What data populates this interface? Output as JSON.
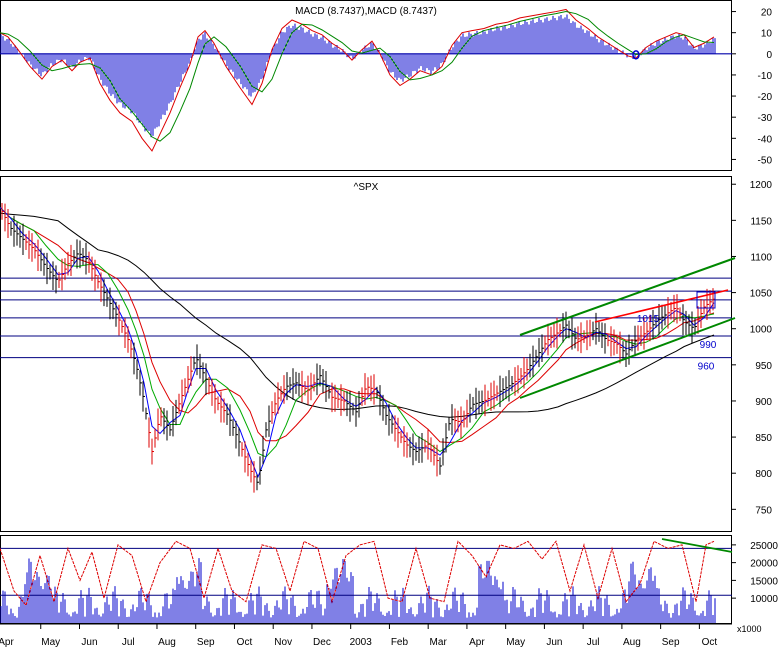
{
  "chart_data": [
    {
      "panel": "macd",
      "type": "bar",
      "title": "MACD (8.7437),MACD (8.7437)",
      "y_ticks": [
        20,
        10,
        0,
        -10,
        -20,
        -30,
        -40,
        -50
      ],
      "ylim": [
        -55,
        25
      ],
      "colors": {
        "histogram": "#0000cc",
        "fast_line": "#dd0000",
        "slow_line": "#008800",
        "zero_line": "#0000aa"
      },
      "annotations": [
        "0"
      ],
      "macd_series": [
        {
          "x": 0,
          "y": 10
        },
        {
          "x": 8,
          "y": 8
        },
        {
          "x": 18,
          "y": 2
        },
        {
          "x": 30,
          "y": -6
        },
        {
          "x": 42,
          "y": -12
        },
        {
          "x": 52,
          "y": -6
        },
        {
          "x": 62,
          "y": -3
        },
        {
          "x": 72,
          "y": -8
        },
        {
          "x": 80,
          "y": -4
        },
        {
          "x": 90,
          "y": -2
        },
        {
          "x": 100,
          "y": -14
        },
        {
          "x": 110,
          "y": -22
        },
        {
          "x": 120,
          "y": -28
        },
        {
          "x": 132,
          "y": -32
        },
        {
          "x": 142,
          "y": -40
        },
        {
          "x": 152,
          "y": -46
        },
        {
          "x": 160,
          "y": -38
        },
        {
          "x": 170,
          "y": -28
        },
        {
          "x": 180,
          "y": -16
        },
        {
          "x": 190,
          "y": -5
        },
        {
          "x": 198,
          "y": 8
        },
        {
          "x": 205,
          "y": 11
        },
        {
          "x": 214,
          "y": 5
        },
        {
          "x": 226,
          "y": -6
        },
        {
          "x": 240,
          "y": -16
        },
        {
          "x": 252,
          "y": -24
        },
        {
          "x": 262,
          "y": -14
        },
        {
          "x": 272,
          "y": 2
        },
        {
          "x": 282,
          "y": 12
        },
        {
          "x": 292,
          "y": 16
        },
        {
          "x": 302,
          "y": 14
        },
        {
          "x": 312,
          "y": 11
        },
        {
          "x": 322,
          "y": 9
        },
        {
          "x": 332,
          "y": 5
        },
        {
          "x": 342,
          "y": 2
        },
        {
          "x": 352,
          "y": -3
        },
        {
          "x": 362,
          "y": 2
        },
        {
          "x": 372,
          "y": 6
        },
        {
          "x": 380,
          "y": 0
        },
        {
          "x": 390,
          "y": -10
        },
        {
          "x": 400,
          "y": -15
        },
        {
          "x": 410,
          "y": -12
        },
        {
          "x": 420,
          "y": -8
        },
        {
          "x": 432,
          "y": -10
        },
        {
          "x": 442,
          "y": -6
        },
        {
          "x": 452,
          "y": 4
        },
        {
          "x": 462,
          "y": 10
        },
        {
          "x": 472,
          "y": 11
        },
        {
          "x": 484,
          "y": 12
        },
        {
          "x": 496,
          "y": 14
        },
        {
          "x": 508,
          "y": 15
        },
        {
          "x": 520,
          "y": 17
        },
        {
          "x": 532,
          "y": 18
        },
        {
          "x": 544,
          "y": 19
        },
        {
          "x": 556,
          "y": 20
        },
        {
          "x": 566,
          "y": 21
        },
        {
          "x": 576,
          "y": 16
        },
        {
          "x": 588,
          "y": 12
        },
        {
          "x": 598,
          "y": 8
        },
        {
          "x": 608,
          "y": 5
        },
        {
          "x": 618,
          "y": 2
        },
        {
          "x": 628,
          "y": -1
        },
        {
          "x": 636,
          "y": -2
        },
        {
          "x": 646,
          "y": 3
        },
        {
          "x": 656,
          "y": 6
        },
        {
          "x": 666,
          "y": 8
        },
        {
          "x": 676,
          "y": 10
        },
        {
          "x": 684,
          "y": 9
        },
        {
          "x": 694,
          "y": 3
        },
        {
          "x": 704,
          "y": 5
        },
        {
          "x": 714,
          "y": 8
        }
      ]
    },
    {
      "panel": "price",
      "type": "line",
      "title": "^SPX",
      "x_ticks": [
        "Apr",
        "May",
        "Jun",
        "Jul",
        "Aug",
        "Sep",
        "Oct",
        "Nov",
        "Dec",
        "2003",
        "Feb",
        "Mar",
        "Apr",
        "May",
        "Jun",
        "Jul",
        "Aug",
        "Sep",
        "Oct"
      ],
      "y_ticks": [
        1200,
        1150,
        1100,
        1050,
        1000,
        950,
        900,
        850,
        800,
        750
      ],
      "ylim": [
        720,
        1210
      ],
      "horizontal_levels": [
        1070,
        1052,
        1040,
        1015,
        990,
        960
      ],
      "level_labels": [
        {
          "text": "1015",
          "value": 1015
        },
        {
          "text": "990",
          "value": 990
        },
        {
          "text": "960",
          "value": 960
        }
      ],
      "colors": {
        "up_bar": "#000000",
        "down_bar": "#dd0000",
        "level_line": "#000080",
        "channel": "#008800",
        "resistance": "#ff0000",
        "ma_long": "#000000",
        "ma_mid": "#dd0000",
        "ma_short": "#00aa00",
        "ma_fast": "#0000ff"
      },
      "price_series": [
        {
          "x": 0,
          "y": 1168
        },
        {
          "x": 10,
          "y": 1140
        },
        {
          "x": 22,
          "y": 1125
        },
        {
          "x": 34,
          "y": 1110
        },
        {
          "x": 46,
          "y": 1085
        },
        {
          "x": 58,
          "y": 1065
        },
        {
          "x": 68,
          "y": 1090
        },
        {
          "x": 78,
          "y": 1105
        },
        {
          "x": 88,
          "y": 1095
        },
        {
          "x": 98,
          "y": 1065
        },
        {
          "x": 108,
          "y": 1040
        },
        {
          "x": 118,
          "y": 1015
        },
        {
          "x": 128,
          "y": 985
        },
        {
          "x": 136,
          "y": 950
        },
        {
          "x": 144,
          "y": 900
        },
        {
          "x": 152,
          "y": 830
        },
        {
          "x": 160,
          "y": 880
        },
        {
          "x": 170,
          "y": 860
        },
        {
          "x": 180,
          "y": 900
        },
        {
          "x": 188,
          "y": 930
        },
        {
          "x": 196,
          "y": 960
        },
        {
          "x": 206,
          "y": 930
        },
        {
          "x": 216,
          "y": 900
        },
        {
          "x": 228,
          "y": 880
        },
        {
          "x": 240,
          "y": 840
        },
        {
          "x": 250,
          "y": 805
        },
        {
          "x": 258,
          "y": 785
        },
        {
          "x": 266,
          "y": 860
        },
        {
          "x": 276,
          "y": 900
        },
        {
          "x": 286,
          "y": 920
        },
        {
          "x": 296,
          "y": 925
        },
        {
          "x": 308,
          "y": 915
        },
        {
          "x": 320,
          "y": 935
        },
        {
          "x": 332,
          "y": 905
        },
        {
          "x": 344,
          "y": 900
        },
        {
          "x": 356,
          "y": 885
        },
        {
          "x": 366,
          "y": 920
        },
        {
          "x": 376,
          "y": 915
        },
        {
          "x": 386,
          "y": 880
        },
        {
          "x": 396,
          "y": 860
        },
        {
          "x": 406,
          "y": 840
        },
        {
          "x": 416,
          "y": 830
        },
        {
          "x": 428,
          "y": 840
        },
        {
          "x": 440,
          "y": 810
        },
        {
          "x": 450,
          "y": 875
        },
        {
          "x": 462,
          "y": 870
        },
        {
          "x": 472,
          "y": 895
        },
        {
          "x": 484,
          "y": 900
        },
        {
          "x": 496,
          "y": 910
        },
        {
          "x": 508,
          "y": 920
        },
        {
          "x": 518,
          "y": 930
        },
        {
          "x": 528,
          "y": 945
        },
        {
          "x": 538,
          "y": 965
        },
        {
          "x": 548,
          "y": 985
        },
        {
          "x": 558,
          "y": 995
        },
        {
          "x": 566,
          "y": 1005
        },
        {
          "x": 576,
          "y": 985
        },
        {
          "x": 586,
          "y": 990
        },
        {
          "x": 596,
          "y": 1000
        },
        {
          "x": 606,
          "y": 985
        },
        {
          "x": 616,
          "y": 980
        },
        {
          "x": 626,
          "y": 965
        },
        {
          "x": 636,
          "y": 985
        },
        {
          "x": 646,
          "y": 995
        },
        {
          "x": 656,
          "y": 1010
        },
        {
          "x": 666,
          "y": 1020
        },
        {
          "x": 676,
          "y": 1030
        },
        {
          "x": 684,
          "y": 1010
        },
        {
          "x": 694,
          "y": 1000
        },
        {
          "x": 704,
          "y": 1030
        },
        {
          "x": 714,
          "y": 1042
        }
      ]
    },
    {
      "panel": "volume",
      "type": "bar",
      "y_ticks": [
        25000,
        20000,
        15000,
        10000
      ],
      "ylim": [
        3000,
        27500
      ],
      "unit_label": "x1000",
      "reference_levels": [
        24000,
        10800
      ],
      "colors": {
        "volume_bar": "#0000cc",
        "oscillator": "#dd0000",
        "trendline": "#008800"
      },
      "oscillator_series": [
        {
          "x": 0,
          "y": 24000
        },
        {
          "x": 14,
          "y": 12000
        },
        {
          "x": 26,
          "y": 8000
        },
        {
          "x": 40,
          "y": 22000
        },
        {
          "x": 54,
          "y": 9000
        },
        {
          "x": 68,
          "y": 24000
        },
        {
          "x": 80,
          "y": 15000
        },
        {
          "x": 92,
          "y": 23000
        },
        {
          "x": 104,
          "y": 10000
        },
        {
          "x": 118,
          "y": 25000
        },
        {
          "x": 132,
          "y": 22000
        },
        {
          "x": 146,
          "y": 9000
        },
        {
          "x": 160,
          "y": 20000
        },
        {
          "x": 176,
          "y": 26000
        },
        {
          "x": 190,
          "y": 24000
        },
        {
          "x": 204,
          "y": 10000
        },
        {
          "x": 218,
          "y": 24000
        },
        {
          "x": 232,
          "y": 12000
        },
        {
          "x": 246,
          "y": 9000
        },
        {
          "x": 262,
          "y": 25000
        },
        {
          "x": 276,
          "y": 24000
        },
        {
          "x": 290,
          "y": 12000
        },
        {
          "x": 304,
          "y": 26000
        },
        {
          "x": 318,
          "y": 24000
        },
        {
          "x": 332,
          "y": 9000
        },
        {
          "x": 346,
          "y": 22000
        },
        {
          "x": 360,
          "y": 25000
        },
        {
          "x": 374,
          "y": 26000
        },
        {
          "x": 388,
          "y": 10000
        },
        {
          "x": 402,
          "y": 9000
        },
        {
          "x": 416,
          "y": 24000
        },
        {
          "x": 430,
          "y": 10000
        },
        {
          "x": 444,
          "y": 9000
        },
        {
          "x": 458,
          "y": 26000
        },
        {
          "x": 472,
          "y": 22000
        },
        {
          "x": 486,
          "y": 16000
        },
        {
          "x": 500,
          "y": 25000
        },
        {
          "x": 514,
          "y": 24000
        },
        {
          "x": 528,
          "y": 26000
        },
        {
          "x": 542,
          "y": 21000
        },
        {
          "x": 556,
          "y": 26000
        },
        {
          "x": 570,
          "y": 12000
        },
        {
          "x": 584,
          "y": 25000
        },
        {
          "x": 598,
          "y": 10000
        },
        {
          "x": 612,
          "y": 24000
        },
        {
          "x": 626,
          "y": 9000
        },
        {
          "x": 640,
          "y": 14000
        },
        {
          "x": 654,
          "y": 26000
        },
        {
          "x": 668,
          "y": 24000
        },
        {
          "x": 682,
          "y": 25000
        },
        {
          "x": 696,
          "y": 9000
        },
        {
          "x": 706,
          "y": 25000
        },
        {
          "x": 714,
          "y": 26000
        }
      ]
    }
  ]
}
